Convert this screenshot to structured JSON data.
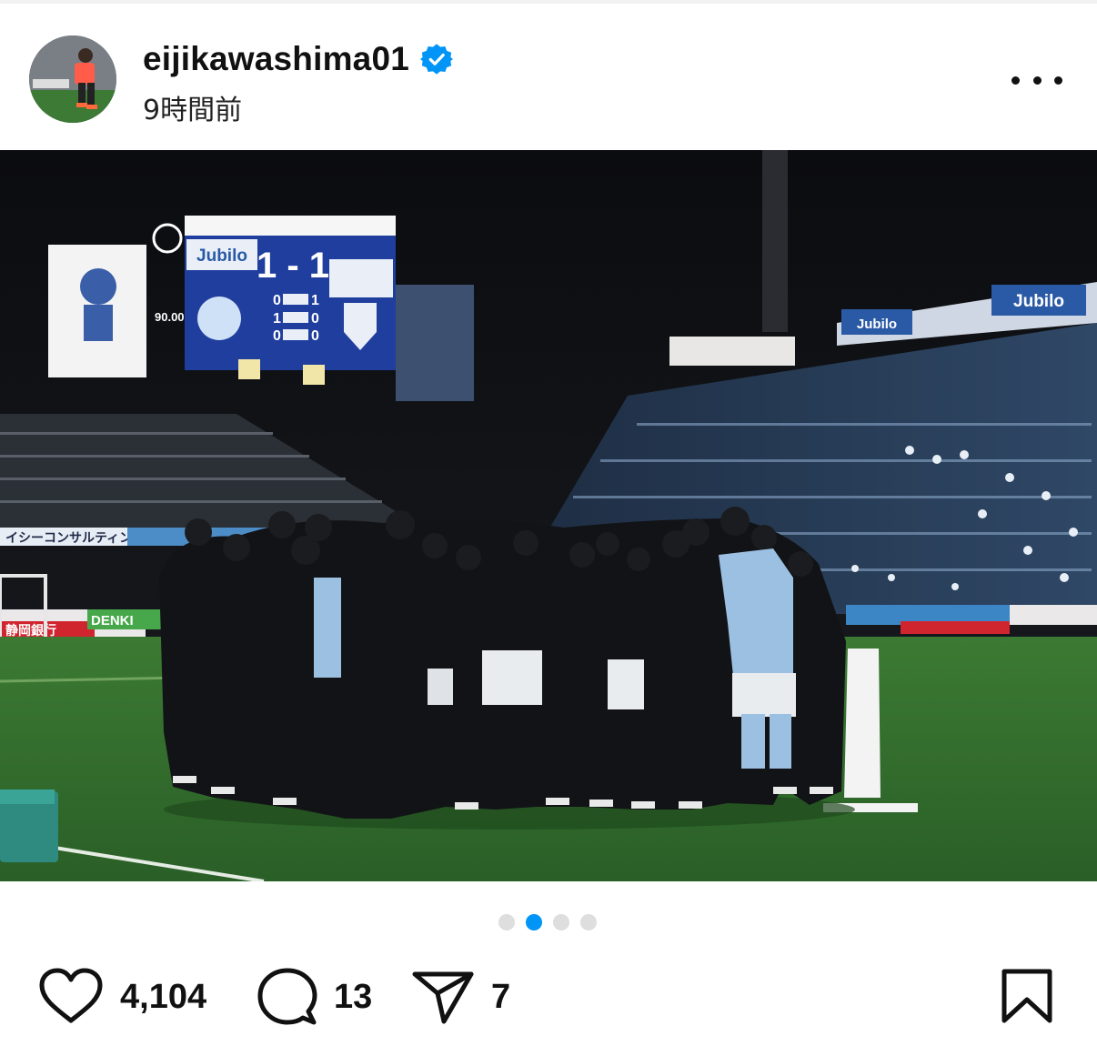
{
  "post": {
    "username": "eijikawashima01",
    "verified": true,
    "time_ago": "9時間前",
    "carousel": {
      "count": 4,
      "active_index": 1
    }
  },
  "photo": {
    "scoreboard": {
      "home_team": "Jubilo",
      "score": "1 - 1",
      "match_time": "90.00",
      "home_breakdown": [
        "0",
        "1",
        "0"
      ],
      "away_breakdown": [
        "1",
        "0",
        "0"
      ]
    },
    "ad_boards": {
      "left_board": "イシーコンサルティング",
      "right_sign": "Jubilo",
      "upper_sign": "Jubilo",
      "green_board": "DENKI",
      "bank_board": "静岡銀行"
    }
  },
  "actions": {
    "likes": "4,104",
    "comments": "13",
    "shares": "7"
  },
  "colors": {
    "accent": "#0095f6",
    "text": "#111111",
    "pitch": "#2f6e2c"
  },
  "icons": [
    "more-icon",
    "verified-badge-icon",
    "heart-icon",
    "comment-icon",
    "share-icon",
    "bookmark-icon"
  ]
}
